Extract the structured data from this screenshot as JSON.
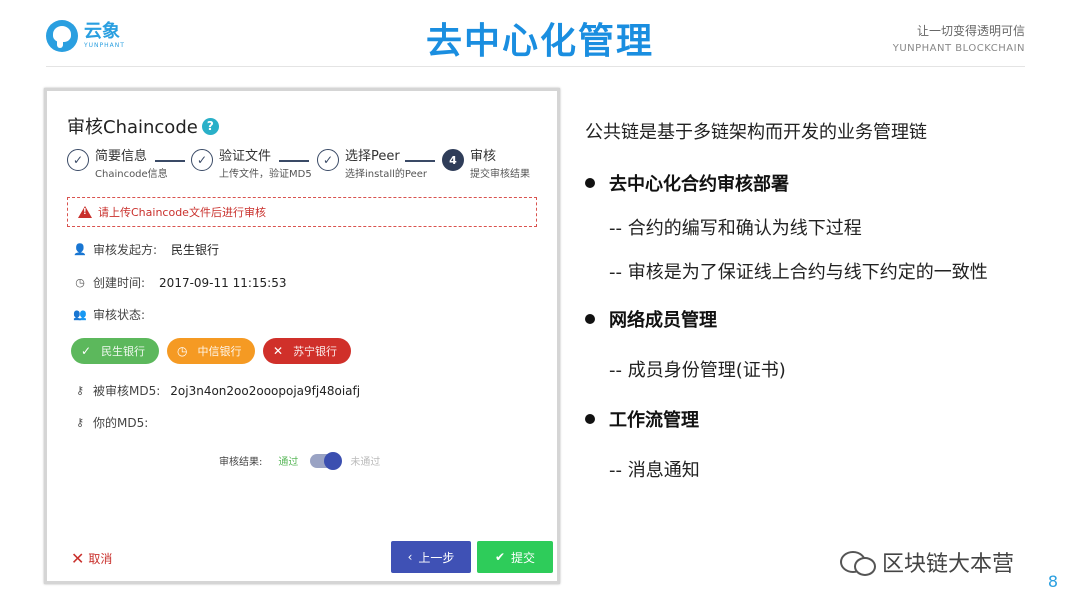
{
  "header": {
    "logo_cn": "云象",
    "logo_en": "YUNPHANT",
    "title": "去中心化管理",
    "slogan_cn": "让一切变得透明可信",
    "slogan_en": "YUNPHANT  BLOCKCHAIN"
  },
  "card": {
    "title": "审核Chaincode",
    "help_glyph": "?",
    "steps": [
      {
        "num": "✓",
        "title": "简要信息",
        "sub": "Chaincode信息"
      },
      {
        "num": "✓",
        "title": "验证文件",
        "sub": "上传文件，验证MD5"
      },
      {
        "num": "✓",
        "title": "选择Peer",
        "sub": "选择install的Peer"
      },
      {
        "num": "4",
        "title": "审核",
        "sub": "提交审核结果"
      }
    ],
    "alert": "请上传Chaincode文件后进行审核",
    "initiator_label": "审核发起方:",
    "initiator_value": "民生银行",
    "time_label": "创建时间:",
    "time_value": "2017-09-11 11:15:53",
    "status_label": "审核状态:",
    "badges": [
      {
        "icon": "✓",
        "text": "民生银行",
        "color": "#5cb85c"
      },
      {
        "icon": "◷",
        "text": "中信银行",
        "color": "#f59a23"
      },
      {
        "icon": "✕",
        "text": "苏宁银行",
        "color": "#d0302a"
      }
    ],
    "md5_label": "被审核MD5:",
    "md5_value": "2oj3n4on2oo2ooopoja9fj48oiafj",
    "your_md5_label": "你的MD5:",
    "result_label": "审核结果:",
    "result_pass": "通过",
    "result_fail": "未通过",
    "toggle_on": true,
    "cancel_label": "取消",
    "prev_label": "上一步",
    "submit_label": "提交"
  },
  "content": {
    "intro": "公共链是基于多链架构而开发的业务管理链",
    "bullet1": "去中心化合约审核部署",
    "sub1a": "-- 合约的编写和确认为线下过程",
    "sub1b": "-- 审核是为了保证线上合约与线下约定的一致性",
    "bullet2": "网络成员管理",
    "sub2a": "-- 成员身份管理(证书)",
    "bullet3": " 工作流管理",
    "sub3a": "-- 消息通知"
  },
  "watermark": "区块链大本营",
  "page_number": "8"
}
